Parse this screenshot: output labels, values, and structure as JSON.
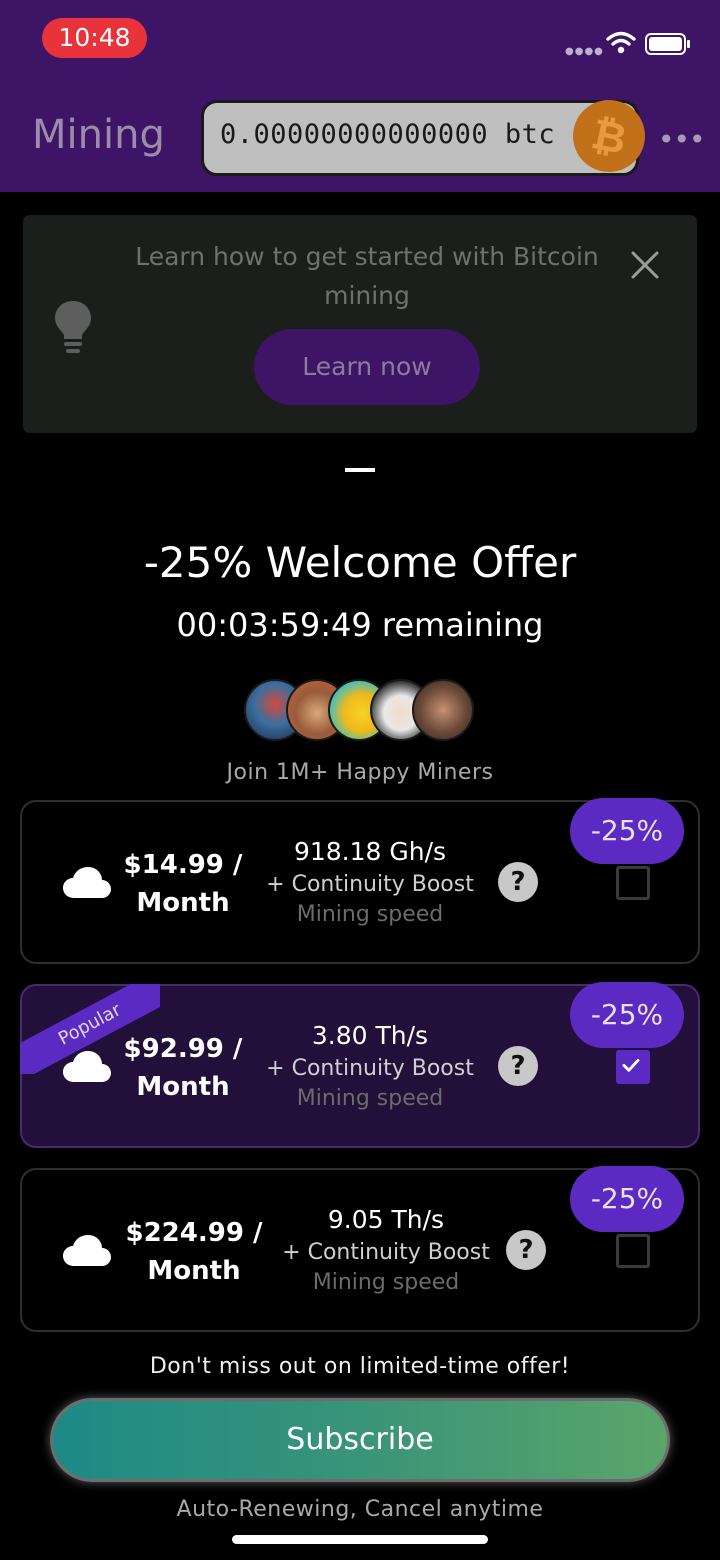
{
  "status_bar": {
    "time": "10:48"
  },
  "header": {
    "title": "Mining",
    "balance": "0.00000000000000 btc",
    "coin_symbol": "₿",
    "menu_glyph": "•••"
  },
  "tip": {
    "text": "Learn how to get started with Bitcoin mining",
    "button_label": "Learn now"
  },
  "offer": {
    "title": "-25% Welcome Offer",
    "timer": "00:03:59:49 remaining",
    "join_text": "Join 1M+ Happy Miners"
  },
  "plans": [
    {
      "price": "$14.99 / Month",
      "speed": "918.18 Gh/s",
      "boost": "+ Continuity Boost",
      "speed_label": "Mining speed",
      "discount": "-25%",
      "selected": false,
      "ribbon": ""
    },
    {
      "price": "$92.99 / Month",
      "speed": "3.80 Th/s",
      "boost": "+ Continuity Boost",
      "speed_label": "Mining speed",
      "discount": "-25%",
      "selected": true,
      "ribbon": "Popular"
    },
    {
      "price": "$224.99 / Month",
      "speed": "9.05 Th/s",
      "boost": "+ Continuity Boost",
      "speed_label": "Mining speed",
      "discount": "-25%",
      "selected": false,
      "ribbon": ""
    }
  ],
  "help_glyph": "?",
  "footer": {
    "missout": "Don't miss out on limited-time offer!",
    "subscribe_label": "Subscribe",
    "auto_renew": "Auto-Renewing, Cancel anytime"
  },
  "colors": {
    "header_bg": "#3d1466",
    "accent": "#5b2ac2",
    "subscribe_start": "#1d8a86",
    "subscribe_end": "#5aa56a"
  },
  "avatars": [
    "robot-art-avatar",
    "monkey-avatar",
    "duck-avatar",
    "cartoon-woman-avatar",
    "man-photo-avatar"
  ]
}
